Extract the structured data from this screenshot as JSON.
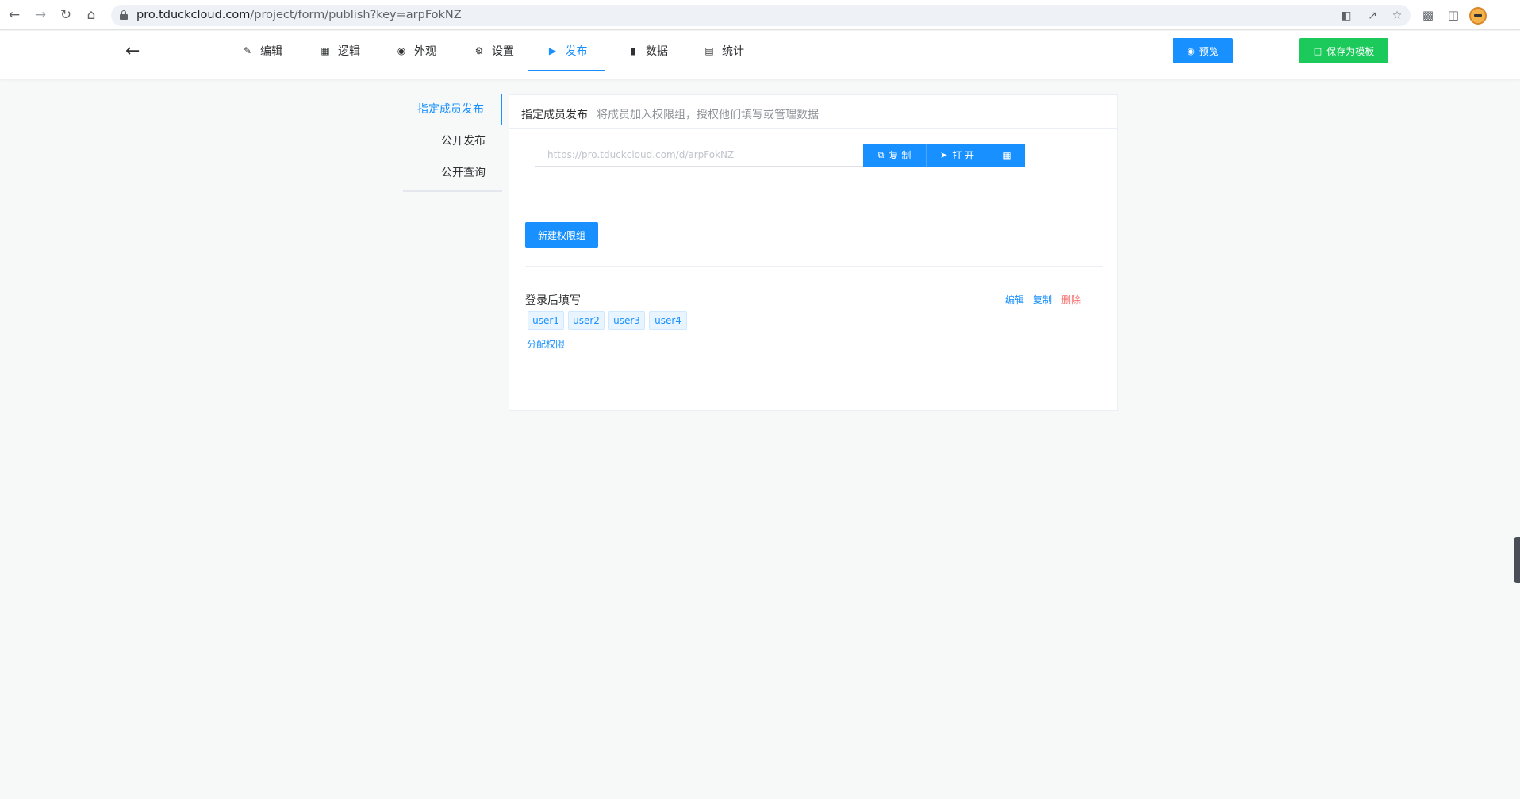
{
  "browser": {
    "url_host": "pro.tduckcloud.com",
    "url_path": "/project/form/publish?key=arpFokNZ"
  },
  "header": {
    "tabs": [
      {
        "label": "编辑",
        "icon": "pen-icon"
      },
      {
        "label": "逻辑",
        "icon": "grid-icon"
      },
      {
        "label": "外观",
        "icon": "eye-icon"
      },
      {
        "label": "设置",
        "icon": "gear-icon"
      },
      {
        "label": "发布",
        "icon": "play-circle-icon"
      },
      {
        "label": "数据",
        "icon": "bar-chart-icon"
      },
      {
        "label": "统计",
        "icon": "chart-board-icon"
      }
    ],
    "active_tab": "发布",
    "preview_label": "预览",
    "save_template_label": "保存为模板"
  },
  "left_menu": {
    "items": [
      {
        "label": "指定成员发布"
      },
      {
        "label": "公开发布"
      },
      {
        "label": "公开查询"
      }
    ],
    "active": "指定成员发布"
  },
  "panel": {
    "title": "指定成员发布",
    "description": "将成员加入权限组，授权他们填写或管理数据",
    "link_url": "https://pro.tduckcloud.com/d/arpFokNZ",
    "copy_label": "复 制",
    "open_label": "打 开",
    "new_group_label": "新建权限组",
    "group": {
      "name": "登录后填写",
      "edit_label": "编辑",
      "copy_label": "复制",
      "delete_label": "删除",
      "users": [
        "user1",
        "user2",
        "user3",
        "user4"
      ],
      "assign_label": "分配权限"
    }
  },
  "colors": {
    "primary": "#1890ff",
    "success": "#1cc95b",
    "danger": "#f56c6c"
  }
}
